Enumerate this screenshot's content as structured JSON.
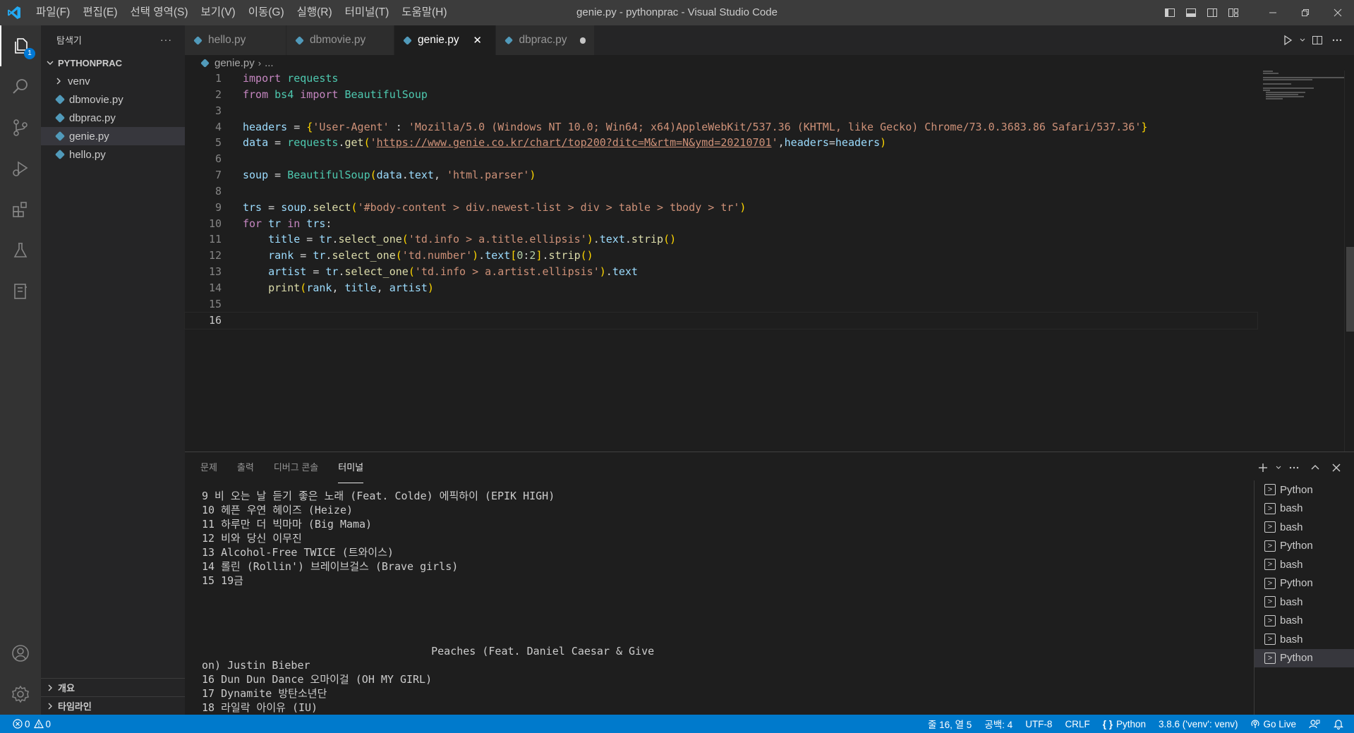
{
  "window": {
    "title": "genie.py - pythonprac - Visual Studio Code"
  },
  "menu": [
    "파일(F)",
    "편집(E)",
    "선택 영역(S)",
    "보기(V)",
    "이동(G)",
    "실행(R)",
    "터미널(T)",
    "도움말(H)"
  ],
  "activity": {
    "explorer_badge": "1"
  },
  "sidebar": {
    "title": "탐색기",
    "more": "···",
    "root": "PYTHONPRAC",
    "items": [
      {
        "label": "venv",
        "type": "folder"
      },
      {
        "label": "dbmovie.py",
        "type": "file"
      },
      {
        "label": "dbprac.py",
        "type": "file"
      },
      {
        "label": "genie.py",
        "type": "file"
      },
      {
        "label": "hello.py",
        "type": "file"
      }
    ],
    "outline": "개요",
    "timeline": "타임라인"
  },
  "tabs": [
    {
      "label": "hello.py"
    },
    {
      "label": "dbmovie.py"
    },
    {
      "label": "genie.py",
      "close": "✕"
    },
    {
      "label": "dbprac.py"
    }
  ],
  "breadcrumb": {
    "file": "genie.py",
    "rest": "..."
  },
  "code": {
    "line_numbers": [
      "1",
      "2",
      "3",
      "4",
      "5",
      "6",
      "7",
      "8",
      "9",
      "10",
      "11",
      "12",
      "13",
      "14",
      "15",
      "16"
    ],
    "l1": {
      "kw": "import",
      "mod": " requests"
    },
    "l2": {
      "kw": "from",
      "mod1": " bs4 ",
      "kw2": "import",
      "mod2": " BeautifulSoup"
    },
    "l4": {
      "var": "headers",
      "eq": " = ",
      "ob": "{",
      "k": "'User-Agent'",
      "colon": " : ",
      "v": "'Mozilla/5.0 (Windows NT 10.0; Win64; x64)AppleWebKit/537.36 (KHTML, like Gecko) Chrome/73.0.3683.86 Safari/537.36'",
      "cb": "}"
    },
    "l5": {
      "var": "data",
      "eq": " = ",
      "mod": "requests",
      "dot": ".",
      "fn": "get",
      "op": "(",
      "q1": "'",
      "url": "https://www.genie.co.kr/chart/top200?ditc=M&rtm=N&ymd=20210701",
      "q2": "'",
      "comma": ",",
      "kwarg": "headers",
      "eq2": "=",
      "var2": "headers",
      "cp": ")"
    },
    "l7": {
      "var": "soup",
      "eq": " = ",
      "fn": "BeautifulSoup",
      "op": "(",
      "a1": "data",
      "dot": ".",
      "a2": "text",
      "comma": ", ",
      "s": "'html.parser'",
      "cp": ")"
    },
    "l9": {
      "var": "trs",
      "eq": " = ",
      "v2": "soup",
      "dot": ".",
      "fn": "select",
      "op": "(",
      "s": "'#body-content > div.newest-list > div > table > tbody > tr'",
      "cp": ")"
    },
    "l10": {
      "kw": "for",
      "v1": " tr ",
      "kw2": "in",
      "v2": " trs",
      "colon": ":"
    },
    "l11": {
      "indent": "    ",
      "var": "title",
      "eq": " = ",
      "v": "tr",
      "dot": ".",
      "fn": "select_one",
      "op": "(",
      "s": "'td.info > a.title.ellipsis'",
      "cp": ")",
      "dot2": ".",
      "a": "text",
      "dot3": ".",
      "fn2": "strip",
      "pp": "()"
    },
    "l12": {
      "indent": "    ",
      "var": "rank",
      "eq": " = ",
      "v": "tr",
      "dot": ".",
      "fn": "select_one",
      "op": "(",
      "s": "'td.number'",
      "cp": ")",
      "dot2": ".",
      "a": "text",
      "ob": "[",
      "n1": "0",
      "colon": ":",
      "n2": "2",
      "cb": "]",
      "dot3": ".",
      "fn2": "strip",
      "pp": "()"
    },
    "l13": {
      "indent": "    ",
      "var": "artist",
      "eq": " = ",
      "v": "tr",
      "dot": ".",
      "fn": "select_one",
      "op": "(",
      "s": "'td.info > a.artist.ellipsis'",
      "cp": ")",
      "dot2": ".",
      "a": "text"
    },
    "l14": {
      "indent": "    ",
      "fn": "print",
      "op": "(",
      "a1": "rank",
      "c1": ", ",
      "a2": "title",
      "c2": ", ",
      "a3": "artist",
      "cp": ")"
    }
  },
  "panel": {
    "tabs": [
      "문제",
      "출력",
      "디버그 콘솔",
      "터미널"
    ],
    "active_tab": "터미널",
    "terminal_lines": [
      "9 비 오는 날 듣기 좋은 노래 (Feat. Colde) 에픽하이 (EPIK HIGH)",
      "10 헤픈 우연 헤이즈 (Heize)",
      "11 하루만 더 빅마마 (Big Mama)",
      "12 비와 당신 이무진",
      "13 Alcohol-Free TWICE (트와이스)",
      "14 롤린 (Rollin') 브레이브걸스 (Brave girls)",
      "15 19금",
      "",
      "",
      "",
      "",
      "                                    Peaches (Feat. Daniel Caesar & Give",
      "on) Justin Bieber",
      "16 Dun Dun Dance 오마이걸 (OH MY GIRL)",
      "17 Dynamite 방탄소년단",
      "18 라일락 아이유 (IU)"
    ],
    "terminals": [
      "Python",
      "bash",
      "bash",
      "Python",
      "bash",
      "Python",
      "bash",
      "bash",
      "bash",
      "Python"
    ]
  },
  "status": {
    "errors": "0",
    "warnings": "0",
    "position": "줄 16, 열 5",
    "spaces": "공백: 4",
    "encoding": "UTF-8",
    "eol": "CRLF",
    "language": "Python",
    "interpreter": "3.8.6 ('venv': venv)",
    "golive": "Go Live"
  },
  "colors": {
    "accent": "#007acc",
    "titlebar": "#3c3c3c",
    "activitybar": "#333333",
    "sidebar": "#252526",
    "editor": "#1e1e1e"
  }
}
